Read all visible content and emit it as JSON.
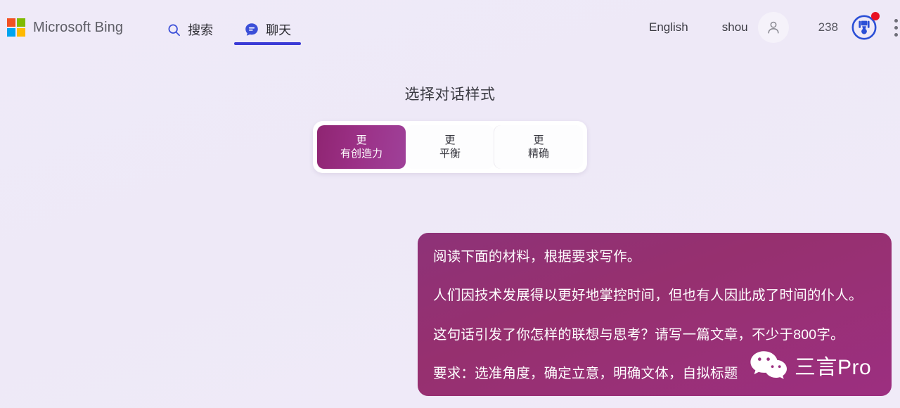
{
  "header": {
    "brand": {
      "name": "Microsoft Bing",
      "logo_icon": "microsoft-logo-icon",
      "colors": {
        "square_top_left": "#f25022",
        "square_top_right": "#7fba00",
        "square_bottom_left": "#00a4ef",
        "square_bottom_right": "#ffb900"
      }
    },
    "nav": [
      {
        "label": "搜索",
        "icon": "search-icon",
        "active": false
      },
      {
        "label": "聊天",
        "icon": "chat-bubble-icon",
        "active": true
      }
    ],
    "right": {
      "language": "English",
      "user_name": "shou",
      "avatar_icon": "person-icon",
      "points": "238",
      "rewards_icon": "rewards-medal-icon",
      "rewards_badge": "notification-dot",
      "menu_icon": "more-vertical-icon"
    },
    "accent_color": "#3b3bd6",
    "badge_color": "#e81123"
  },
  "style_picker": {
    "title": "选择对话样式",
    "options": [
      {
        "line1": "更",
        "line2": "有创造力",
        "selected": true
      },
      {
        "line1": "更",
        "line2": "平衡",
        "selected": false
      },
      {
        "line1": "更",
        "line2": "精确",
        "selected": false
      }
    ],
    "selected_color": "#9b3086"
  },
  "conversation": {
    "message": {
      "role": "user",
      "bubble_color": "#96306f",
      "lines": [
        "阅读下面的材料，根据要求写作。",
        "人们因技术发展得以更好地掌控时间，但也有人因此成了时间的仆人。",
        "这句话引发了你怎样的联想与思考？请写一篇文章，不少于800字。",
        "要求：选准角度，确定立意，明确文体，自拟标题"
      ]
    }
  },
  "watermark": {
    "icon": "wechat-logo-icon",
    "text": "三言Pro"
  }
}
